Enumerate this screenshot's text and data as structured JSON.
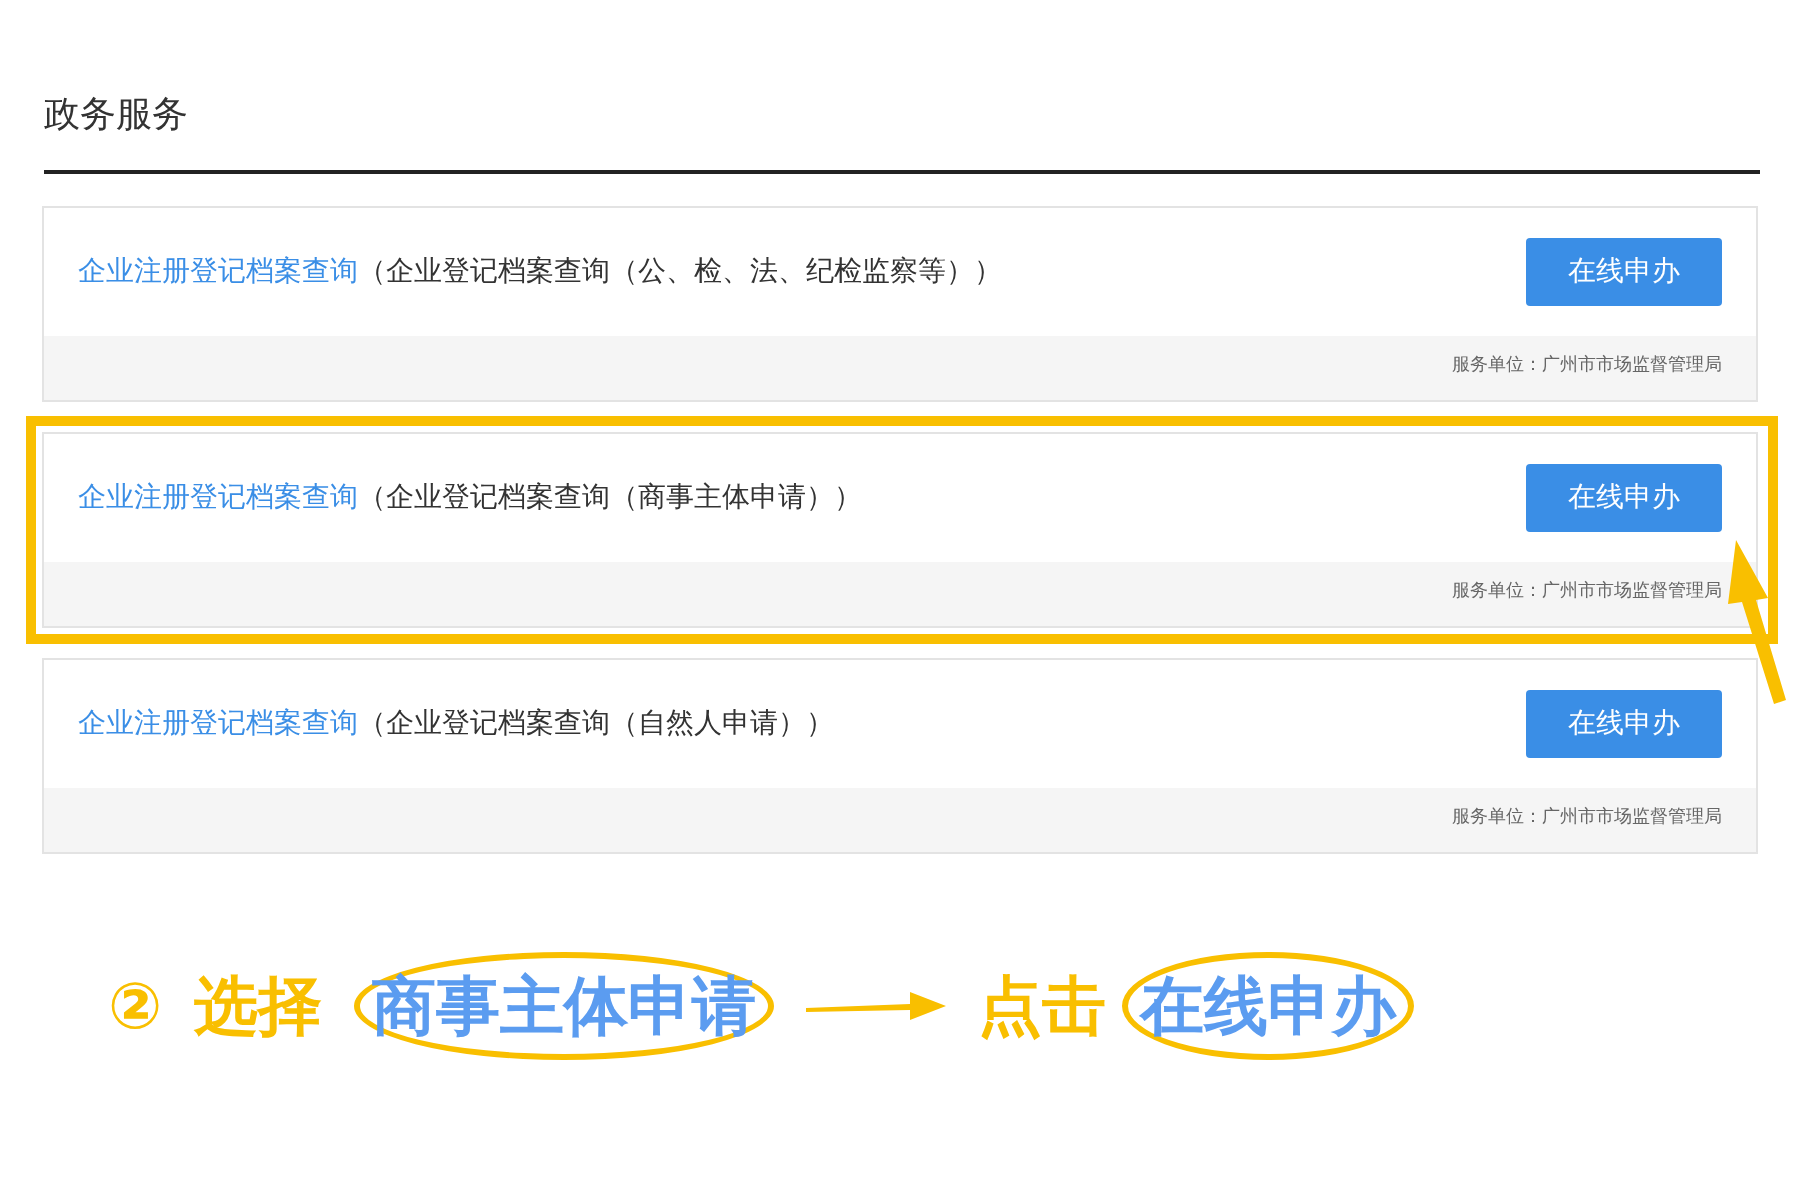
{
  "section_title": "政务服务",
  "services": [
    {
      "name": "企业注册登记档案查询",
      "detail": "（企业登记档案查询（公、检、法、纪检监察等））",
      "button": "在线申办",
      "footer": "服务单位：广州市市场监督管理局",
      "highlighted": false
    },
    {
      "name": "企业注册登记档案查询",
      "detail": "（企业登记档案查询（商事主体申请））",
      "button": "在线申办",
      "footer": "服务单位：广州市市场监督管理局",
      "highlighted": true
    },
    {
      "name": "企业注册登记档案查询",
      "detail": "（企业登记档案查询（自然人申请））",
      "button": "在线申办",
      "footer": "服务单位：广州市市场监督管理局",
      "highlighted": false
    }
  ],
  "annotation": {
    "step": "②",
    "verb1": "选择",
    "target1": "商事主体申请",
    "verb2": "点击",
    "target2": "在线申办"
  }
}
